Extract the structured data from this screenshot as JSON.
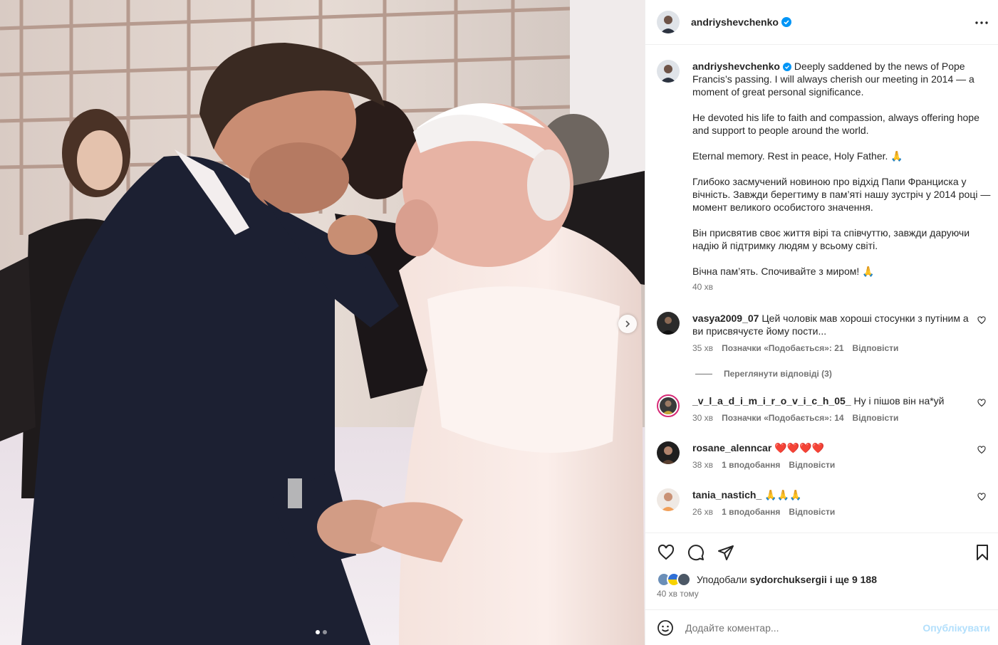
{
  "post": {
    "author": "andriyshevchenko",
    "more_icon": "more-horizontal-icon",
    "caption": {
      "text_1": "Deeply saddened by the news of Pope Francis’s passing. I will always cherish our meeting in 2014 — a moment of great personal significance.",
      "text_2": "He devoted his life to faith and compassion, always offering hope and support to people around the world.",
      "text_3": "Eternal memory. Rest in peace, Holy Father. 🙏",
      "text_4": "Глибоко засмучений новиною про відхід Папи Франциска у вічність. Завжди берегтиму в пам’яті нашу зустріч у 2014 році — момент великого особистого значення.",
      "text_5": "Він присвятив своє життя вірі та співчуттю, завжди даруючи надію й підтримку людям у всьому світі.",
      "text_6": "Вічна пам’ять. Спочивайте з миром! 🙏",
      "time": "40 хв"
    }
  },
  "comments": [
    {
      "username": "vasya2009_07",
      "text": "Цей чоловік мав хороші стосунки з путіним а ви присвячуєте йому пости...",
      "time": "35 хв",
      "likes": "Позначки «Подобається»: 21",
      "reply": "Відповісти"
    },
    {
      "username": "_v_l_a_d_i_m_i_r_o_v_i_c_h_05_",
      "text": "Ну і пішов він на*уй",
      "time": "30 хв",
      "likes": "Позначки «Подобається»: 14",
      "reply": "Відповісти"
    },
    {
      "username": "rosane_alenncar",
      "text": "❤️❤️❤️❤️",
      "time": "38 хв",
      "likes": "1 вподобання",
      "reply": "Відповісти"
    },
    {
      "username": "tania_nastich_",
      "text": "🙏🙏🙏",
      "time": "26 хв",
      "likes": "1 вподобання",
      "reply": "Відповісти"
    }
  ],
  "view_replies": "Переглянути відповіді (3)",
  "actions": {
    "likes_prefix": "Уподобали",
    "likes_user": "sydorchuksergii",
    "likes_suffix": "і ще 9 188",
    "post_time": "40 хв тому"
  },
  "add_comment": {
    "placeholder": "Додайте коментар...",
    "publish": "Опублікувати"
  },
  "colors": {
    "accent_verified": "#0095f6",
    "publish_disabled": "#b2dffc",
    "secondary_text": "#737373"
  },
  "carousel": {
    "current": 1,
    "total": 2
  }
}
